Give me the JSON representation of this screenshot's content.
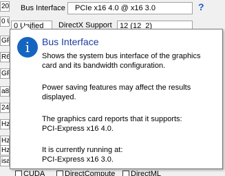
{
  "background": {
    "left_cells": [
      "20",
      "0 Unified",
      "GP",
      "R6",
      "GP",
      "a8",
      "24",
      "Hz",
      "Hz",
      "Hz",
      "isa"
    ],
    "top_label": "Bus Interface",
    "top_value": "PCIe x16 4.0 @ x16 3.0",
    "help_glyph": "?",
    "row2_left": "DirectX Support",
    "row2_right": "12 (12_2)",
    "bottom_items": [
      "CUDA",
      "DirectCompute",
      "DirectML"
    ]
  },
  "tooltip": {
    "icon": "info-icon",
    "icon_glyph": "i",
    "title": "Bus Interface",
    "line1": "Shows the system bus interface of the graphics",
    "line2": "card and its bandwidth configuration.",
    "line3": "Power saving features may affect the results",
    "line4": "displayed.",
    "line5": "The graphics card reports that it supports:",
    "line6": "PCI-Express x16 4.0.",
    "line7": "It is currently running at:",
    "line8": "PCI-Express x16 3.0."
  },
  "colors": {
    "accent": "#1565c0",
    "title": "#1a3c9c",
    "help": "#1a57c8"
  }
}
